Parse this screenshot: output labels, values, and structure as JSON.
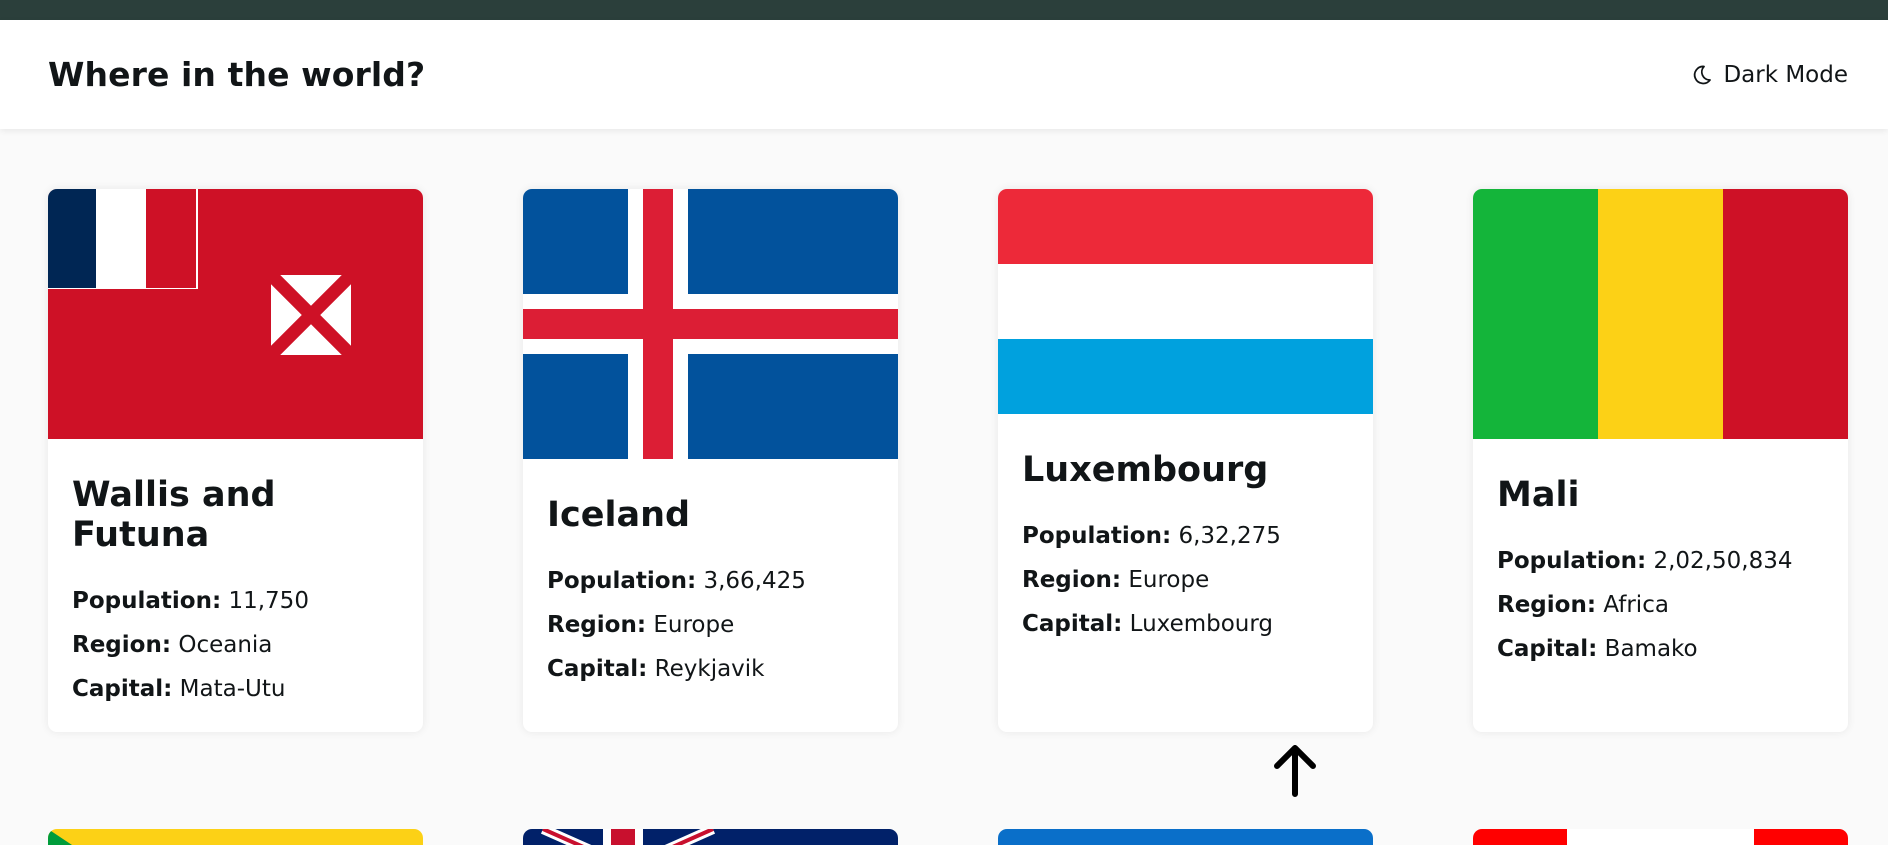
{
  "header": {
    "title": "Where in the world?",
    "dark_mode_label": "Dark Mode"
  },
  "countries": [
    {
      "name": "Wallis and Futuna",
      "population_label": "Population:",
      "population": "11,750",
      "region_label": "Region:",
      "region": "Oceania",
      "capital_label": "Capital:",
      "capital": "Mata-Utu",
      "flag": "wallis-and-futuna-flag"
    },
    {
      "name": "Iceland",
      "population_label": "Population:",
      "population": "3,66,425",
      "region_label": "Region:",
      "region": "Europe",
      "capital_label": "Capital:",
      "capital": "Reykjavik",
      "flag": "iceland-flag"
    },
    {
      "name": "Luxembourg",
      "population_label": "Population:",
      "population": "6,32,275",
      "region_label": "Region:",
      "region": "Europe",
      "capital_label": "Capital:",
      "capital": "Luxembourg",
      "flag": "luxembourg-flag"
    },
    {
      "name": "Mali",
      "population_label": "Population:",
      "population": "2,02,50,834",
      "region_label": "Region:",
      "region": "Africa",
      "capital_label": "Capital:",
      "capital": "Bamako",
      "flag": "mali-flag"
    }
  ],
  "icons": {
    "dark_mode": "moon-icon",
    "scroll_top": "arrow-up-icon"
  },
  "colors": {
    "background": "#fafafa",
    "card": "#ffffff",
    "text": "#111517",
    "top_strip": "#2b3f3b"
  }
}
